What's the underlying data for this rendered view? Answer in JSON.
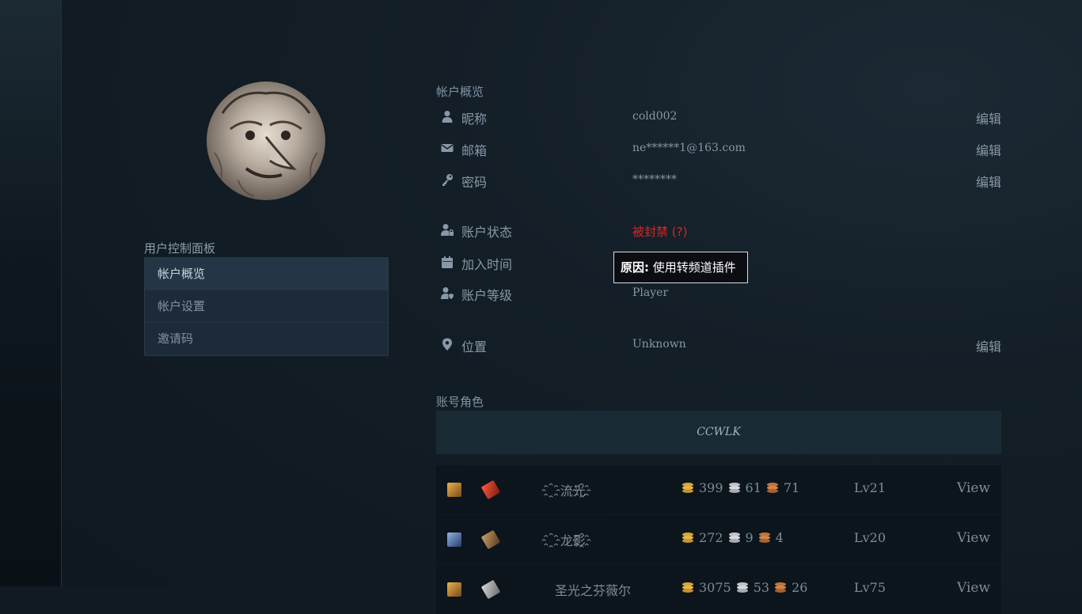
{
  "sidebar": {
    "panel_title": "用户控制面板",
    "items": [
      {
        "label": "帐户概览",
        "active": true
      },
      {
        "label": "帐户设置",
        "active": false
      },
      {
        "label": "邀请码",
        "active": false
      }
    ]
  },
  "overview": {
    "title": "帐户概览",
    "nickname": {
      "label": "昵称",
      "value": "cold002",
      "edit": "编辑",
      "icon": "user-icon"
    },
    "email": {
      "label": "邮箱",
      "value": "ne******1@163.com",
      "edit": "编辑",
      "icon": "envelope-icon"
    },
    "password": {
      "label": "密码",
      "value": "********",
      "edit": "编辑",
      "icon": "key-icon"
    },
    "status": {
      "label": "账户状态",
      "value": "被封禁 (?)",
      "icon": "user-lock-icon",
      "color": "#e0241d"
    },
    "joined": {
      "label": "加入时间",
      "value": "",
      "icon": "calendar-icon"
    },
    "level": {
      "label": "账户等级",
      "value": "Player",
      "icon": "user-shield-icon"
    },
    "location": {
      "label": "位置",
      "value": "Unknown",
      "edit": "编辑",
      "icon": "map-pin-icon"
    }
  },
  "tooltip": {
    "prefix": "原因:",
    "text": "使用转频道插件"
  },
  "characters": {
    "title": "账号角色",
    "realm": "CCWLK",
    "rows": [
      {
        "name": "҈流光҈",
        "gold": "399",
        "silver": "61",
        "copper": "71",
        "level": "Lv21",
        "view": "View"
      },
      {
        "name": "҈龙影҈",
        "gold": "272",
        "silver": "9",
        "copper": "4",
        "level": "Lv20",
        "view": "View"
      },
      {
        "name": "圣光之芬薇尔",
        "gold": "3075",
        "silver": "53",
        "copper": "26",
        "level": "Lv75",
        "view": "View"
      }
    ]
  }
}
